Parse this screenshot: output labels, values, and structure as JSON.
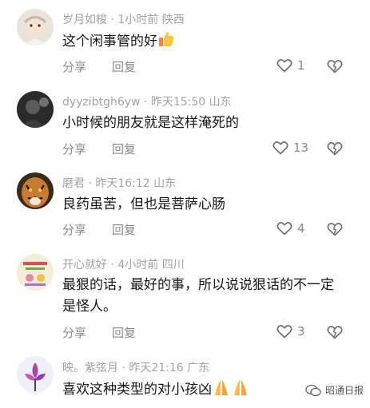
{
  "comments": [
    {
      "username": "岁月如梭",
      "time": "1小时前",
      "location": "陕西",
      "content": "这个闲事管的好",
      "emoji": "thumbs-up",
      "reply_label": "分享",
      "reply2_label": "回复",
      "likes": "1"
    },
    {
      "username": "dyyzibtgh6yw",
      "time": "昨天15:50",
      "location": "山东",
      "content": "小时候的朋友就是这样淹死的",
      "reply_label": "分享",
      "reply2_label": "回复",
      "likes": "13"
    },
    {
      "username": "磨君",
      "time": "昨天16:12",
      "location": "山东",
      "content": "良药虽苦，但也是菩萨心肠",
      "reply_label": "分享",
      "reply2_label": "回复",
      "likes": "4"
    },
    {
      "username": "开心就好",
      "time": "4小时前",
      "location": "四川",
      "content": "最狠的话，最好的事，所以说说狠话的不一定是怪人。",
      "reply_label": "分享",
      "reply2_label": "回复",
      "likes": "3"
    },
    {
      "username": "映。紫弦月",
      "time": "昨天21:16",
      "location": "广东",
      "content": "喜欢这种类型的对小孩凶",
      "emoji": "praying-hands"
    }
  ],
  "watermark": {
    "text": "昭通日报"
  },
  "colors": {
    "meta": "#a2a2a2",
    "action": "#8a8a8a",
    "text": "#161616"
  }
}
